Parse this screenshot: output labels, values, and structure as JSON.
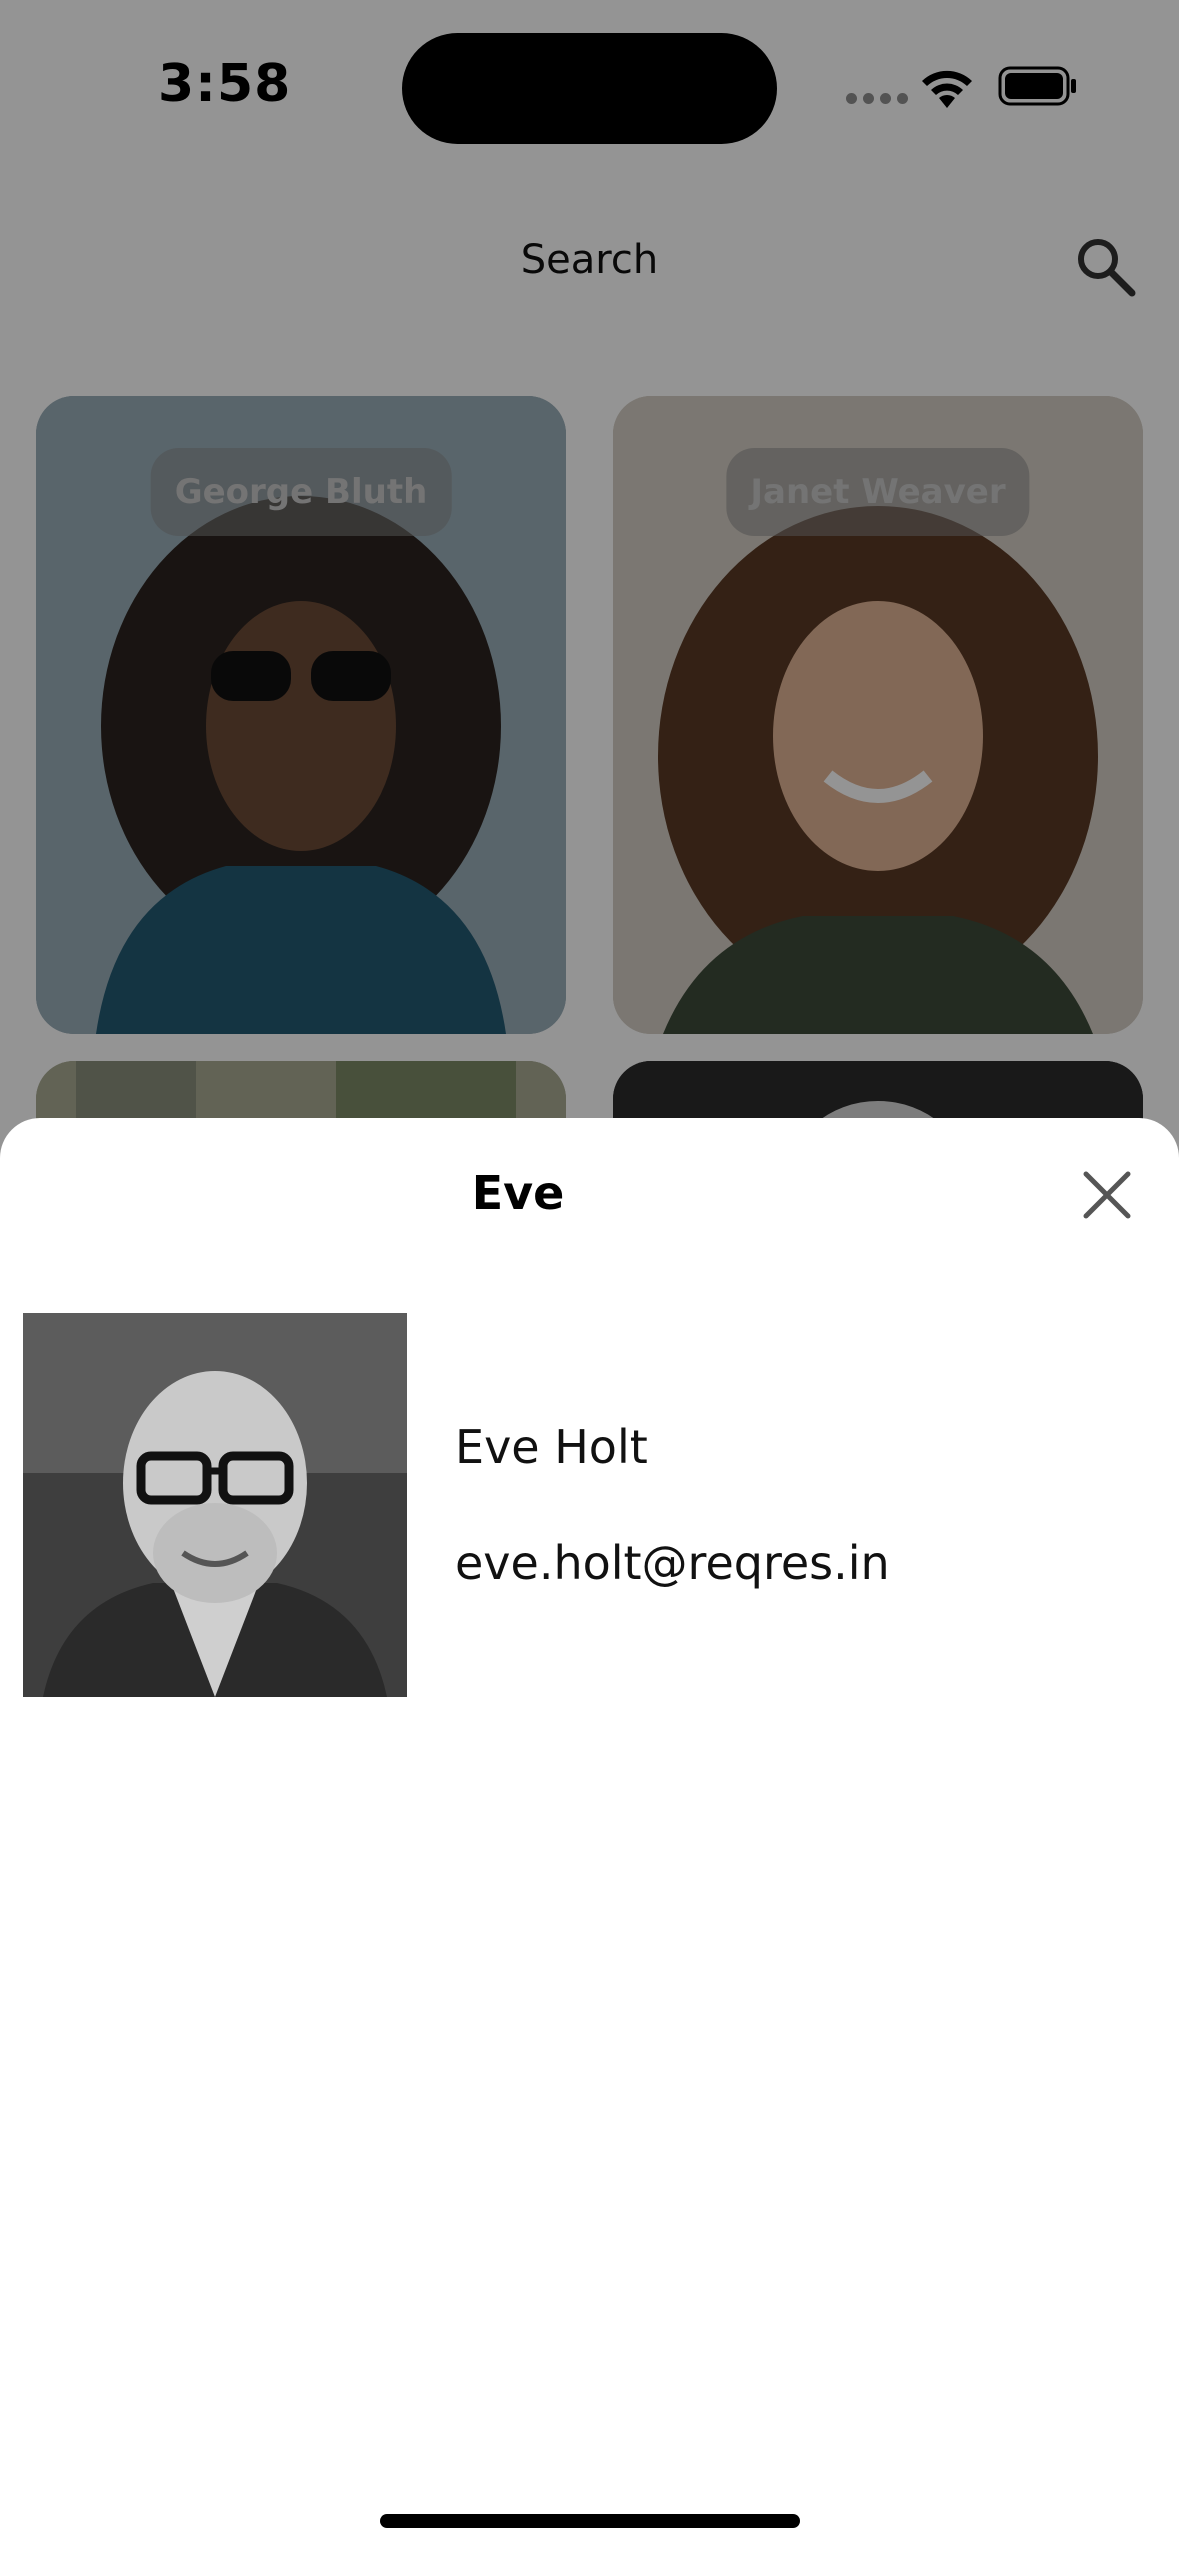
{
  "status": {
    "time": "3:58"
  },
  "header": {
    "title": "Search",
    "search_icon": "search-icon"
  },
  "users": [
    {
      "name": "George Bluth"
    },
    {
      "name": "Janet Weaver"
    }
  ],
  "sheet": {
    "title": "Eve",
    "close_icon": "close-icon",
    "name": "Eve Holt",
    "email": "eve.holt@reqres.in"
  },
  "colors": {
    "sheet_bg": "#ffffff",
    "text": "#111111",
    "overlay": "#000000"
  }
}
